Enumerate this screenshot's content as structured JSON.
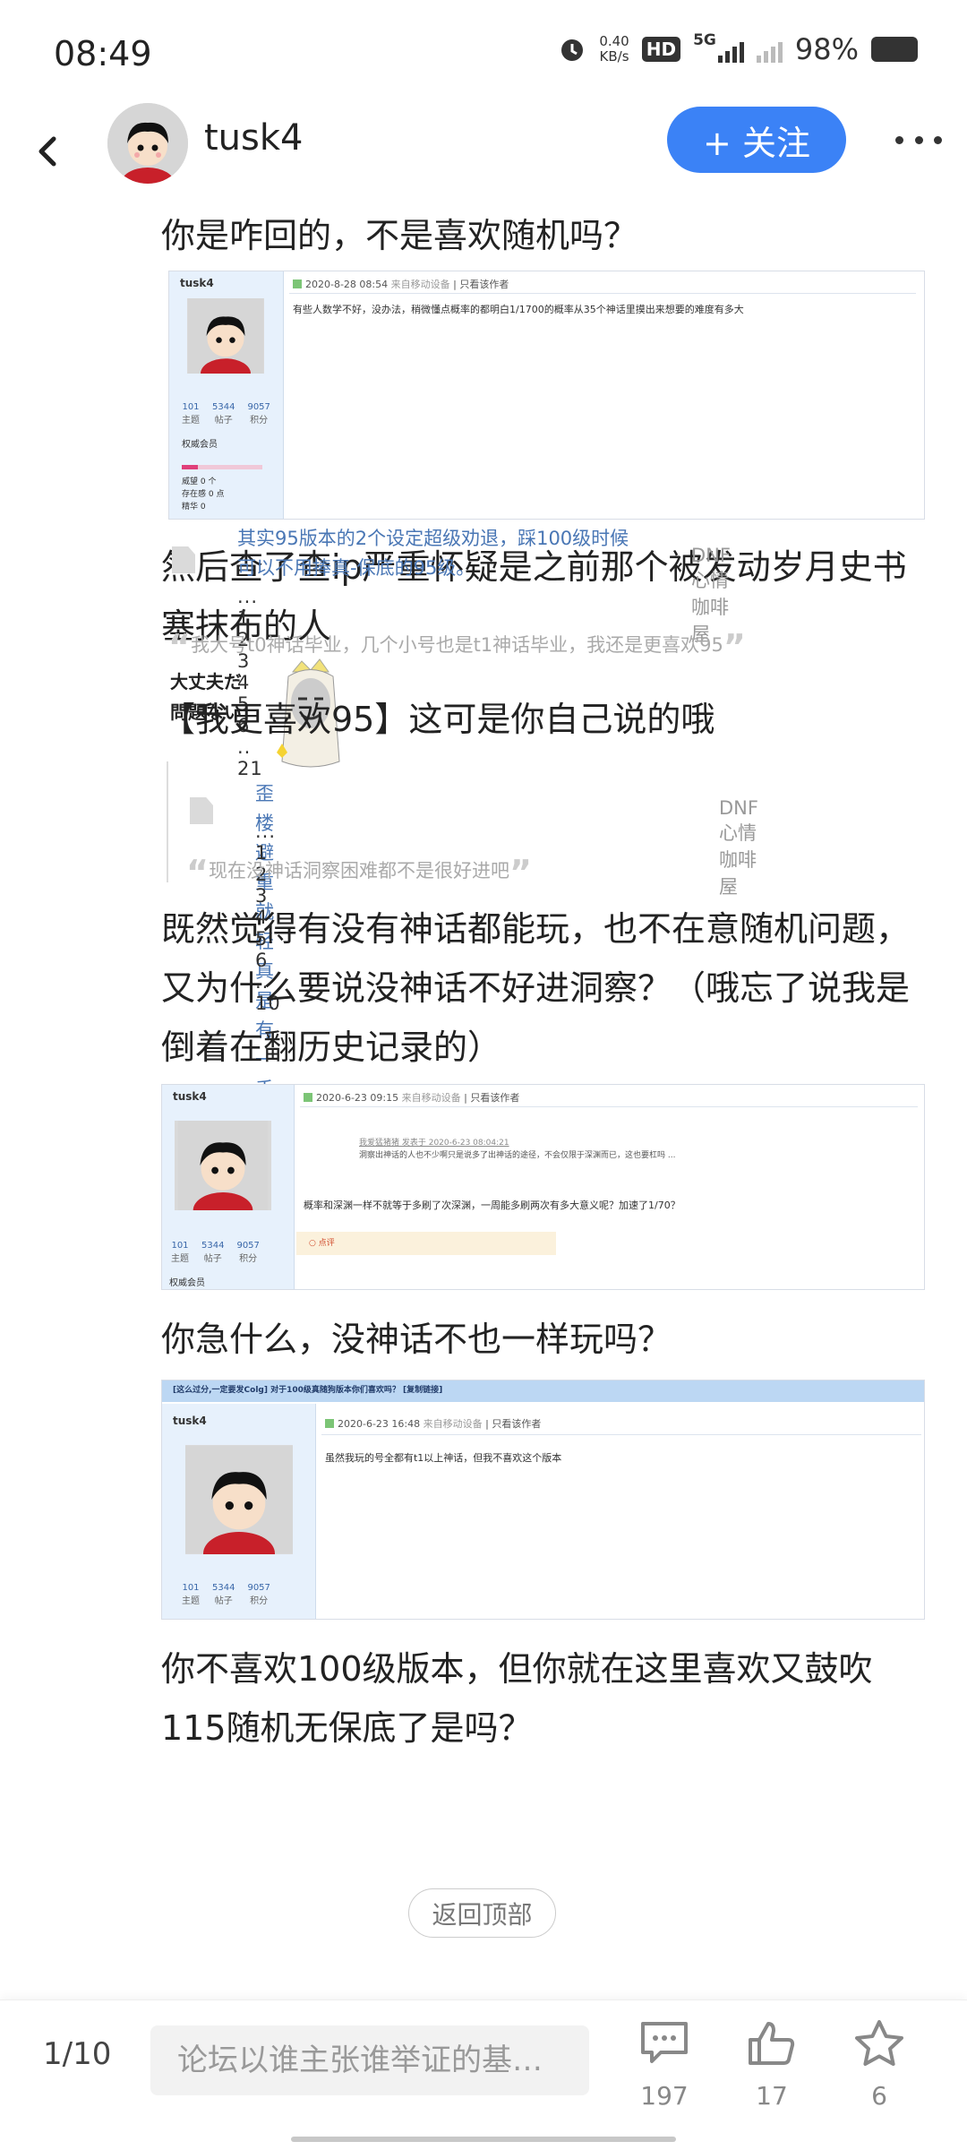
{
  "status": {
    "time": "08:49",
    "speed_value": "0.40",
    "speed_unit": "KB/s",
    "hd": "HD",
    "network": "5G",
    "battery": "98%"
  },
  "header": {
    "username": "tusk4",
    "follow_label": "+ 关注"
  },
  "post": {
    "p1": "你是咋回的，不是喜欢随机吗？",
    "shot1": {
      "user": "tusk4",
      "date": "2020-8-28 08:54",
      "source": "来自移动设备",
      "author_only": "只看该作者",
      "body": "有些人数学不好，没办法，稍微懂点概率的都明白1/1700的概率从35个神话里摸出来想要的难度有多大",
      "stats": [
        {
          "n": "101",
          "l": "主题"
        },
        {
          "n": "5344",
          "l": "帖子"
        },
        {
          "n": "9057",
          "l": "积分"
        }
      ],
      "vip": "权威会员",
      "rows": [
        "威望   0 个",
        "存在感   0 点",
        "精华   0"
      ]
    },
    "p2": "然后查了查ip严重怀疑是之前那个被发动岁月史书塞抹布的人",
    "meme_text": [
      "大丈夫だ",
      "問題ない"
    ],
    "link1": {
      "title_line1": "其实95版本的2个设定超级劝退，踩100级时候",
      "title_line2": "可以不用捧真-保底的95级。",
      "pages": "... 1  2  3  4  5  6 .. 21",
      "forum": "DNF心情咖啡屋",
      "quote": "我大号t0神话毕业，几个小号也是t1神话毕业，我还是更喜欢95"
    },
    "p3": "【我更喜欢95】这可是你自己说的哦",
    "link2": {
      "title": "歪楼避重就轻真是有一手的",
      "pages": "... 1  2  3  4  5  6 .. 10",
      "forum": "DNF心情咖啡屋",
      "quote": "现在没神话洞察困难都不是很好进吧"
    },
    "p4": "既然觉得有没有神话都能玩，也不在意随机问题，又为什么要说没神话不好进洞察？（哦忘了说我是倒着在翻历史记录的）",
    "shot2": {
      "user": "tusk4",
      "date": "2020-6-23 09:15",
      "source": "来自移动设备",
      "author_only": "只看该作者",
      "quote_head": "我爱猛猪猪 发表于 2020-6-23 08:04:21",
      "quote_body": "洞察出神话的人也不少啊只是说多了出神话的途径，不会仅限于深渊而已，这也要杠吗 ...",
      "body": "概率和深渊一样不就等于多刷了次深渊，一周能多刷两次有多大意义呢？加速了1/70？",
      "stats": [
        {
          "n": "101",
          "l": "主题"
        },
        {
          "n": "5344",
          "l": "帖子"
        },
        {
          "n": "9057",
          "l": "积分"
        }
      ],
      "vip": "权威会员",
      "rate": "点评"
    },
    "p5": "你急什么，没神话不也一样玩吗？",
    "shot3": {
      "banner": "[这么过分,一定要发Colg] 对于100级真随狗版本你们喜欢吗？ [复制链接]",
      "user": "tusk4",
      "date": "2020-6-23 16:48",
      "source": "来自移动设备",
      "author_only": "只看该作者",
      "body": "虽然我玩的号全都有t1以上神话，但我不喜欢这个版本",
      "stats": [
        {
          "n": "101",
          "l": "主题"
        },
        {
          "n": "5344",
          "l": "帖子"
        },
        {
          "n": "9057",
          "l": "积分"
        }
      ]
    },
    "p6": "你不喜欢100级版本，但你就在这里喜欢又鼓吹115随机无保底了是吗？"
  },
  "back_to_top": "返回顶部",
  "bottom": {
    "page": "1/10",
    "reply_placeholder": "论坛以谁主张谁举证的基…",
    "comments": "197",
    "likes": "17",
    "favorites": "6"
  }
}
